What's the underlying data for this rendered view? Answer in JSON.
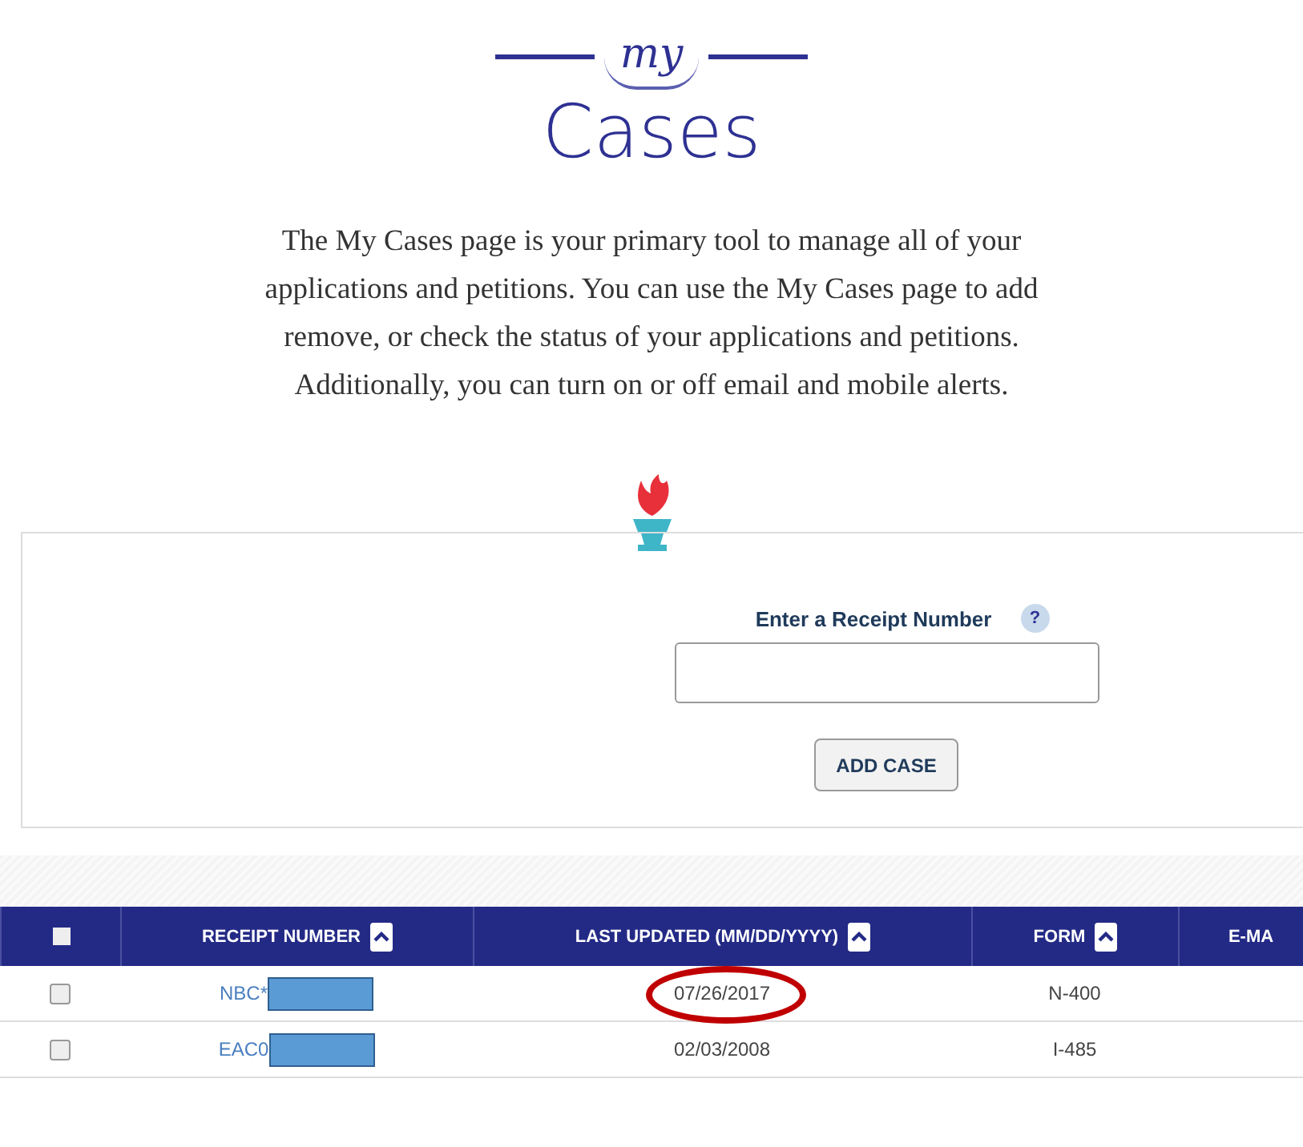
{
  "logo": {
    "script": "my",
    "title": "Cases"
  },
  "intro": "The My Cases page is your primary tool to manage all of your applications and petitions. You can use the My Cases page to add remove, or check the status of your applications and petitions. Additionally, you can turn on or off email and mobile alerts.",
  "add_case": {
    "label": "Enter a Receipt Number",
    "help": "?",
    "button": "ADD CASE"
  },
  "table": {
    "select_all_checked": false,
    "columns": [
      {
        "label": "RECEIPT NUMBER",
        "sortable": true
      },
      {
        "label": "LAST UPDATED (MM/DD/YYYY)",
        "sortable": true
      },
      {
        "label": "FORM",
        "sortable": true
      },
      {
        "label": "E-MA",
        "sortable": false
      }
    ],
    "rows": [
      {
        "checked": false,
        "receipt": "NBC*",
        "redacted": true,
        "updated": "07/26/2017",
        "circled": true,
        "form": "N-400"
      },
      {
        "checked": false,
        "receipt": "EAC0",
        "redacted": true,
        "updated": "02/03/2008",
        "circled": false,
        "form": "I-485"
      }
    ]
  }
}
